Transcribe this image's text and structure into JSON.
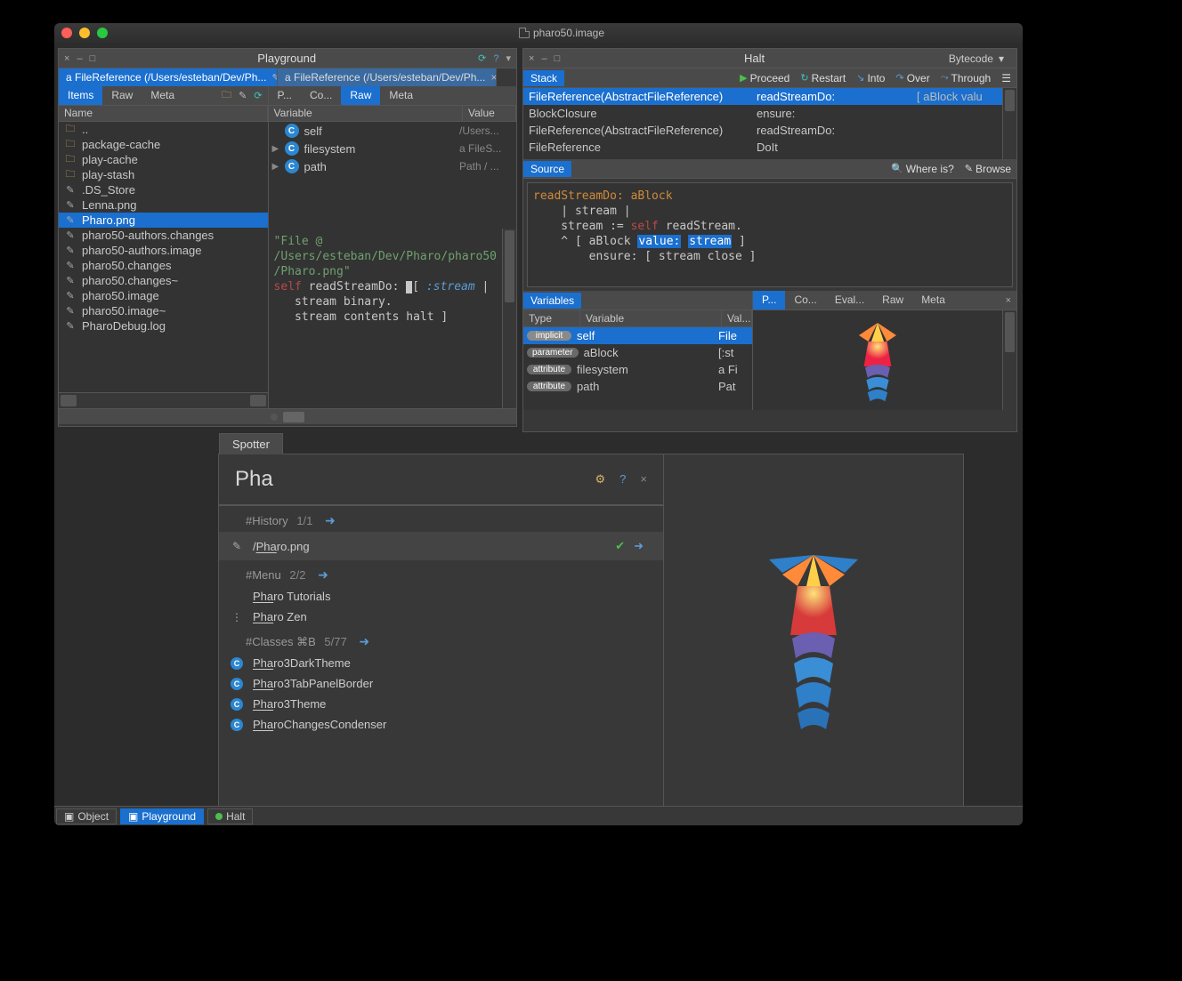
{
  "os_window_title": "pharo50.image",
  "playground": {
    "title": "Playground",
    "tabs": [
      {
        "label": "a FileReference (/Users/esteban/Dev/Ph...",
        "active": true
      },
      {
        "label": "a FileReference (/Users/esteban/Dev/Ph...",
        "active": false
      }
    ],
    "left": {
      "view_tabs": [
        "Items",
        "Raw",
        "Meta"
      ],
      "active_view_tab": "Items",
      "column_header": "Name",
      "items": [
        {
          "name": "..",
          "kind": "folder",
          "selected": false
        },
        {
          "name": "package-cache",
          "kind": "folder",
          "selected": false
        },
        {
          "name": "play-cache",
          "kind": "folder",
          "selected": false
        },
        {
          "name": "play-stash",
          "kind": "folder",
          "selected": false
        },
        {
          "name": ".DS_Store",
          "kind": "file",
          "selected": false
        },
        {
          "name": "Lenna.png",
          "kind": "file",
          "selected": false
        },
        {
          "name": "Pharo.png",
          "kind": "file",
          "selected": true
        },
        {
          "name": "pharo50-authors.changes",
          "kind": "file",
          "selected": false
        },
        {
          "name": "pharo50-authors.image",
          "kind": "file",
          "selected": false
        },
        {
          "name": "pharo50.changes",
          "kind": "file",
          "selected": false
        },
        {
          "name": "pharo50.changes~",
          "kind": "file",
          "selected": false
        },
        {
          "name": "pharo50.image",
          "kind": "file",
          "selected": false
        },
        {
          "name": "pharo50.image~",
          "kind": "file",
          "selected": false
        },
        {
          "name": "PharoDebug.log",
          "kind": "file",
          "selected": false
        }
      ]
    },
    "right": {
      "view_tabs": [
        "P...",
        "Co...",
        "Raw",
        "Meta"
      ],
      "active_view_tab": "Raw",
      "columns": [
        "Variable",
        "Value"
      ],
      "variables": [
        {
          "name": "self",
          "value": "/Users...",
          "expandable": false
        },
        {
          "name": "filesystem",
          "value": "a FileS...",
          "expandable": true
        },
        {
          "name": "path",
          "value": "Path / ...",
          "expandable": true
        }
      ],
      "code": {
        "comment": "\"File @\n/Users/esteban/Dev/Pharo/pharo50\n/Pharo.png\"",
        "line1_pre": "self",
        "line1_msg": " readStreamDo: ",
        "line1_blk_open": "[",
        "line1_var": " :stream ",
        "line1_blk_bar": "|",
        "line2": "   stream binary.",
        "line3_pre": "   stream ",
        "line3_mid": "contents halt ",
        "line3_end": "]"
      }
    }
  },
  "halt": {
    "title": "Halt",
    "toolbar_right": "Bytecode",
    "actions": [
      "Proceed",
      "Restart",
      "Into",
      "Over",
      "Through"
    ],
    "stack_label": "Stack",
    "stack": [
      {
        "class": "FileReference(AbstractFileReference)",
        "msg": "readStreamDo:",
        "blk": "[ aBlock valu",
        "selected": true
      },
      {
        "class": "BlockClosure",
        "msg": "ensure:",
        "blk": "",
        "selected": false
      },
      {
        "class": "FileReference(AbstractFileReference)",
        "msg": "readStreamDo:",
        "blk": "",
        "selected": false
      },
      {
        "class": "FileReference",
        "msg": "DoIt",
        "blk": "",
        "selected": false
      }
    ],
    "source_label": "Source",
    "source_tools": [
      "Where is?",
      "Browse"
    ],
    "source_code": {
      "l1": "readStreamDo: aBlock",
      "l2": "    | stream |",
      "l3_a": "    stream := ",
      "l3_b": "self",
      "l3_c": " readStream.",
      "l4_a": "    ^ [ aBlock ",
      "l4_sel1": "value:",
      "l4_mid": " ",
      "l4_sel2": "stream",
      "l4_c": " ]",
      "l5": "        ensure: [ stream close ]"
    },
    "variables_label": "Variables",
    "var_columns": [
      "Type",
      "Variable",
      "Val..."
    ],
    "variables": [
      {
        "type": "implicit",
        "name": "self",
        "value": "File",
        "selected": true
      },
      {
        "type": "parameter",
        "name": "aBlock",
        "value": "[:st",
        "selected": false
      },
      {
        "type": "attribute",
        "name": "filesystem",
        "value": "a Fi",
        "selected": false
      },
      {
        "type": "attribute",
        "name": "path",
        "value": "Pat",
        "selected": false
      }
    ],
    "preview_tabs": [
      "P...",
      "Co...",
      "Eval...",
      "Raw",
      "Meta"
    ],
    "preview_active_tab": "P..."
  },
  "spotter": {
    "tab_label": "Spotter",
    "query": "Pha",
    "sections": [
      {
        "header": "#History",
        "count": "1/1",
        "items": [
          {
            "label": "/Pharo.png",
            "icon": "pencil",
            "selected": true,
            "check": true
          }
        ]
      },
      {
        "header": "#Menu",
        "count": "2/2",
        "items": [
          {
            "label": "Pharo Tutorials",
            "icon": ""
          },
          {
            "label": "Pharo Zen",
            "icon": "dots"
          }
        ]
      },
      {
        "header": "#Classes  ⌘B",
        "count": "5/77",
        "items": [
          {
            "label": "Pharo3DarkTheme",
            "icon": "class"
          },
          {
            "label": "Pharo3TabPanelBorder",
            "icon": "class"
          },
          {
            "label": "Pharo3Theme",
            "icon": "class"
          },
          {
            "label": "PharoChangesCondenser",
            "icon": "class"
          }
        ]
      }
    ]
  },
  "taskbar": {
    "items": [
      {
        "label": "Object",
        "active": false,
        "icon": "object"
      },
      {
        "label": "Playground",
        "active": true,
        "icon": "playground"
      },
      {
        "label": "Halt",
        "active": false,
        "icon": "halt"
      }
    ]
  }
}
